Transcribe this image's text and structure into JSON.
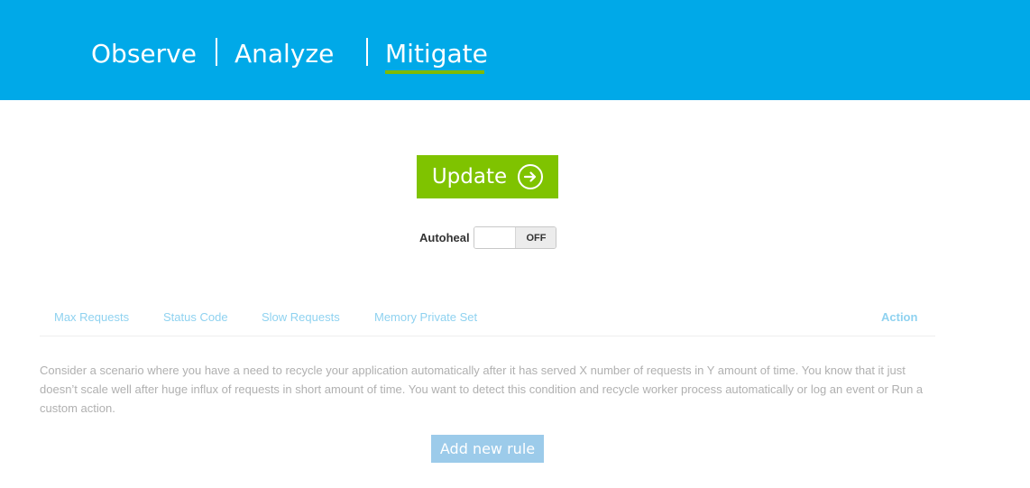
{
  "nav": {
    "items": [
      {
        "label": "Observe"
      },
      {
        "label": "Analyze"
      },
      {
        "label": "Mitigate",
        "active": true
      }
    ],
    "active_underline_color": "#7fba00"
  },
  "header": {
    "background_color": "#00a9e8"
  },
  "update_button": {
    "label": "Update",
    "icon": "arrow-circle-right-icon",
    "color": "#7fc300"
  },
  "autoheal": {
    "label": "Autoheal",
    "state": "OFF"
  },
  "rule_tabs": {
    "items": [
      {
        "label": "Max Requests"
      },
      {
        "label": "Status Code"
      },
      {
        "label": "Slow Requests"
      },
      {
        "label": "Memory Private Set"
      }
    ],
    "action_label": "Action"
  },
  "description": "Consider a scenario where you have a need to recycle your application automatically after it has served X number of requests in Y amount of time. You know that it just doesn’t scale well after huge influx of requests in short amount of time. You want to detect this condition and recycle worker process automatically or log an event or Run a custom action.",
  "add_rule_button": {
    "label": "Add new rule"
  }
}
